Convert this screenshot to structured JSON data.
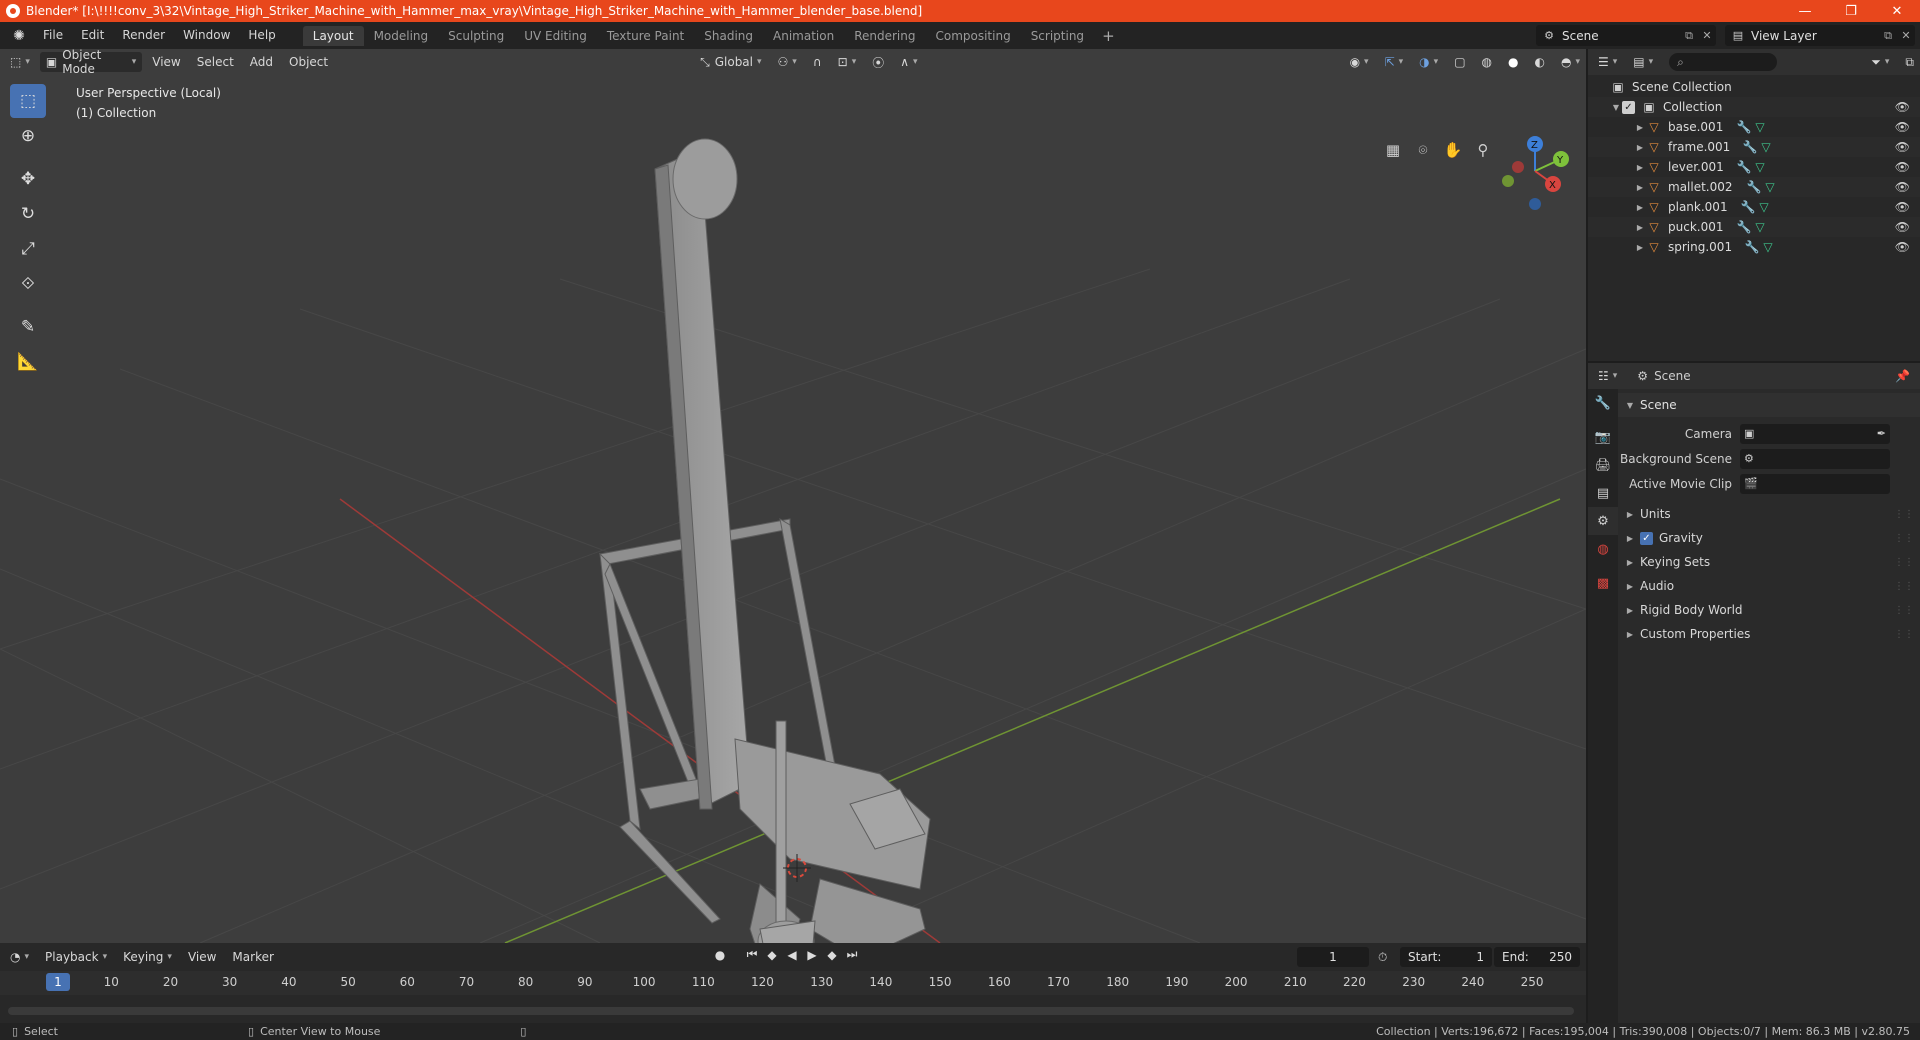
{
  "window": {
    "title": "Blender* [I:\\!!!!conv_3\\32\\Vintage_High_Striker_Machine_with_Hammer_max_vray\\Vintage_High_Striker_Machine_with_Hammer_blender_base.blend]",
    "minimize": "—",
    "maximize": "❐",
    "close": "✕"
  },
  "menubar": {
    "items": [
      "File",
      "Edit",
      "Render",
      "Window",
      "Help"
    ],
    "workspaces": [
      "Layout",
      "Modeling",
      "Sculpting",
      "UV Editing",
      "Texture Paint",
      "Shading",
      "Animation",
      "Rendering",
      "Compositing",
      "Scripting"
    ],
    "active_workspace": "Layout",
    "add_workspace": "+",
    "scene": "Scene",
    "view_layer": "View Layer"
  },
  "viewport": {
    "mode": "Object Mode",
    "menus": [
      "View",
      "Select",
      "Add",
      "Object"
    ],
    "orientation": "Global",
    "info_line1": "User Perspective (Local)",
    "info_line2": "(1) Collection",
    "gizmo": {
      "x": "X",
      "y": "Y",
      "z": "Z"
    }
  },
  "toolbar": {
    "tools": [
      "select-box",
      "cursor",
      "move",
      "rotate",
      "scale",
      "transform",
      "annotate",
      "measure"
    ]
  },
  "outliner": {
    "search_placeholder": "⌕",
    "root": "Scene Collection",
    "collection": "Collection",
    "objects": [
      "base.001",
      "frame.001",
      "lever.001",
      "mallet.002",
      "plank.001",
      "puck.001",
      "spring.001"
    ]
  },
  "properties": {
    "header": "Scene",
    "panel": "Scene",
    "camera_label": "Camera",
    "background_scene_label": "Background Scene",
    "active_movie_clip_label": "Active Movie Clip",
    "subpanels": [
      "Units",
      "Gravity",
      "Keying Sets",
      "Audio",
      "Rigid Body World",
      "Custom Properties"
    ],
    "gravity_checked": true
  },
  "timeline": {
    "menus": [
      "Playback",
      "Keying",
      "View",
      "Marker"
    ],
    "current_frame": "1",
    "start_label": "Start:",
    "start": "1",
    "end_label": "End:",
    "end": "250",
    "ticks": [
      "10",
      "20",
      "30",
      "40",
      "50",
      "60",
      "70",
      "80",
      "90",
      "100",
      "110",
      "120",
      "130",
      "140",
      "150",
      "160",
      "170",
      "180",
      "190",
      "200",
      "210",
      "220",
      "230",
      "240",
      "250"
    ],
    "cursor_label": "1"
  },
  "statusbar": {
    "left": "Select",
    "middle": "Center View to Mouse",
    "stats": "Collection | Verts:196,672 | Faces:195,004 | Tris:390,008 | Objects:0/7 | Mem: 86.3 MB | v2.80.75"
  },
  "colors": {
    "titlebar": "#e8471c",
    "accent": "#4772b3",
    "object_icon": "#e08a3c",
    "mesh_icon": "#3ec48c",
    "x_axis": "#d9453f",
    "y_axis": "#7ec13b",
    "z_axis": "#3d7fd9"
  }
}
